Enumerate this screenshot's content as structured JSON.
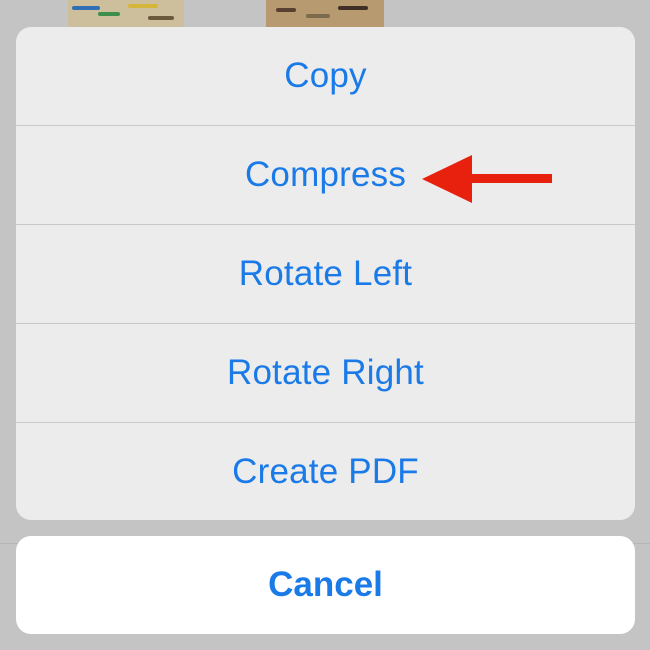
{
  "action_sheet": {
    "items": [
      {
        "label": "Copy"
      },
      {
        "label": "Compress"
      },
      {
        "label": "Rotate Left"
      },
      {
        "label": "Rotate Right"
      },
      {
        "label": "Create PDF"
      }
    ]
  },
  "cancel": {
    "label": "Cancel"
  },
  "annotation": {
    "icon": "left-arrow-icon",
    "color": "#e8210f",
    "points_to": "Compress"
  },
  "colors": {
    "accent": "#1a7ae8",
    "sheet_background": "#ececec",
    "cancel_background": "#ffffff",
    "backdrop": "#c4c4c4"
  }
}
